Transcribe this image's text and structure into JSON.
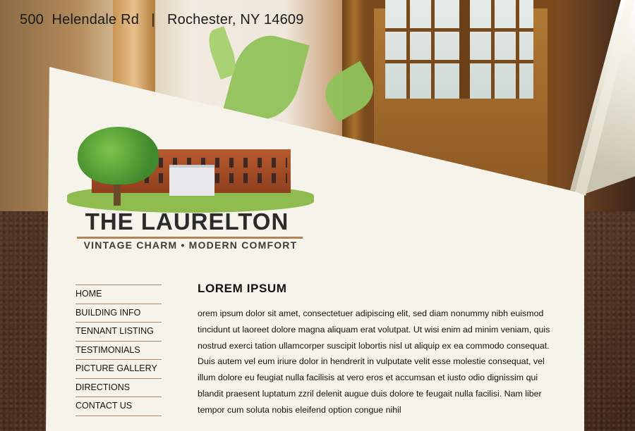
{
  "header": {
    "address": "500  Helendale Rd   |   Rochester, NY 14609"
  },
  "logo": {
    "title": "THE LAURELTON",
    "tagline": "VINTAGE CHARM • MODERN COMFORT"
  },
  "nav": {
    "items": [
      {
        "label": "HOME"
      },
      {
        "label": "BUILDING INFO"
      },
      {
        "label": "TENNANT LISTING"
      },
      {
        "label": "TESTIMONIALS"
      },
      {
        "label": "PICTURE GALLERY"
      },
      {
        "label": "DIRECTIONS"
      },
      {
        "label": "CONTACT US"
      }
    ]
  },
  "main": {
    "heading": "LOREM IPSUM",
    "body": "orem ipsum dolor sit amet, consectetuer adipiscing elit, sed diam nonummy nibh euismod tincidunt ut laoreet dolore magna aliquam erat volutpat. Ut wisi enim ad minim veniam, quis nostrud exerci tation ullamcorper suscipit lobortis nisl ut aliquip ex ea commodo consequat. Duis autem vel eum iriure dolor in hendrerit in vulputate velit esse molestie consequat, vel illum dolore eu feugiat nulla facilisis at vero eros et accumsan et iusto odio dignissim qui blandit praesent luptatum zzril delenit augue duis dolore te feugait nulla facilisi. Nam liber tempor cum soluta nobis eleifend option congue nihil"
  },
  "colors": {
    "paper": "#f6f4ea",
    "leather": "#4a2f20",
    "nav_rule": "#a88a6a"
  }
}
